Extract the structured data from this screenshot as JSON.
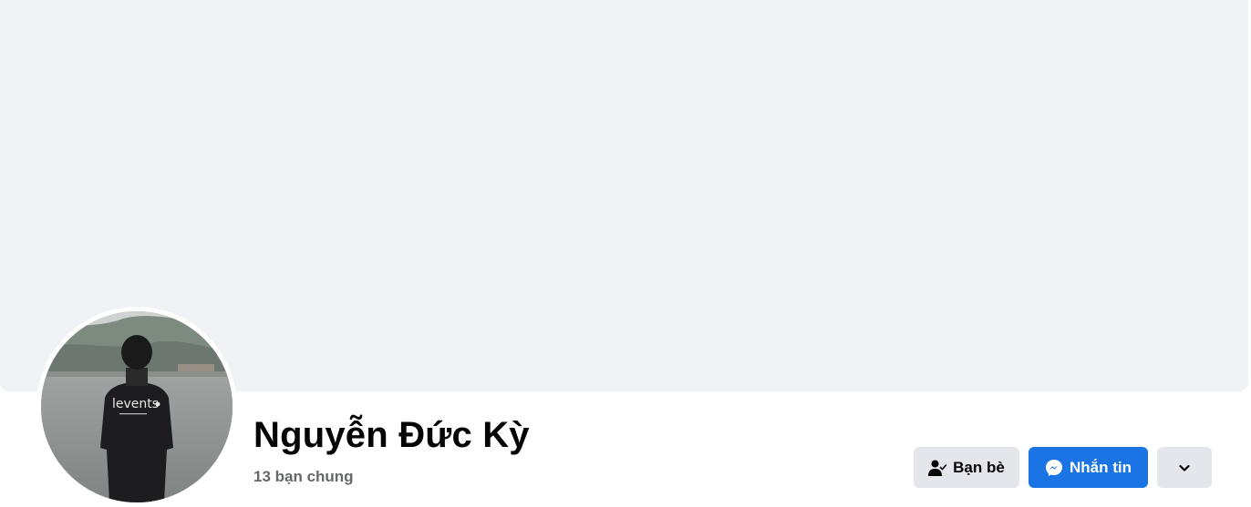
{
  "profile": {
    "name": "Nguyễn Đức Kỳ",
    "mutual_friends": "13 bạn chung",
    "avatar_shirt_text": "levents"
  },
  "actions": {
    "friends_label": "Bạn bè",
    "message_label": "Nhắn tin"
  },
  "icons": {
    "friends": "person-check-icon",
    "message": "messenger-icon",
    "more": "chevron-down-icon"
  },
  "colors": {
    "cover": "#f0f2f5",
    "primary_button": "#1b74e4",
    "secondary_button": "#e4e6eb",
    "name_text": "#050505",
    "sub_text": "#65676b"
  }
}
